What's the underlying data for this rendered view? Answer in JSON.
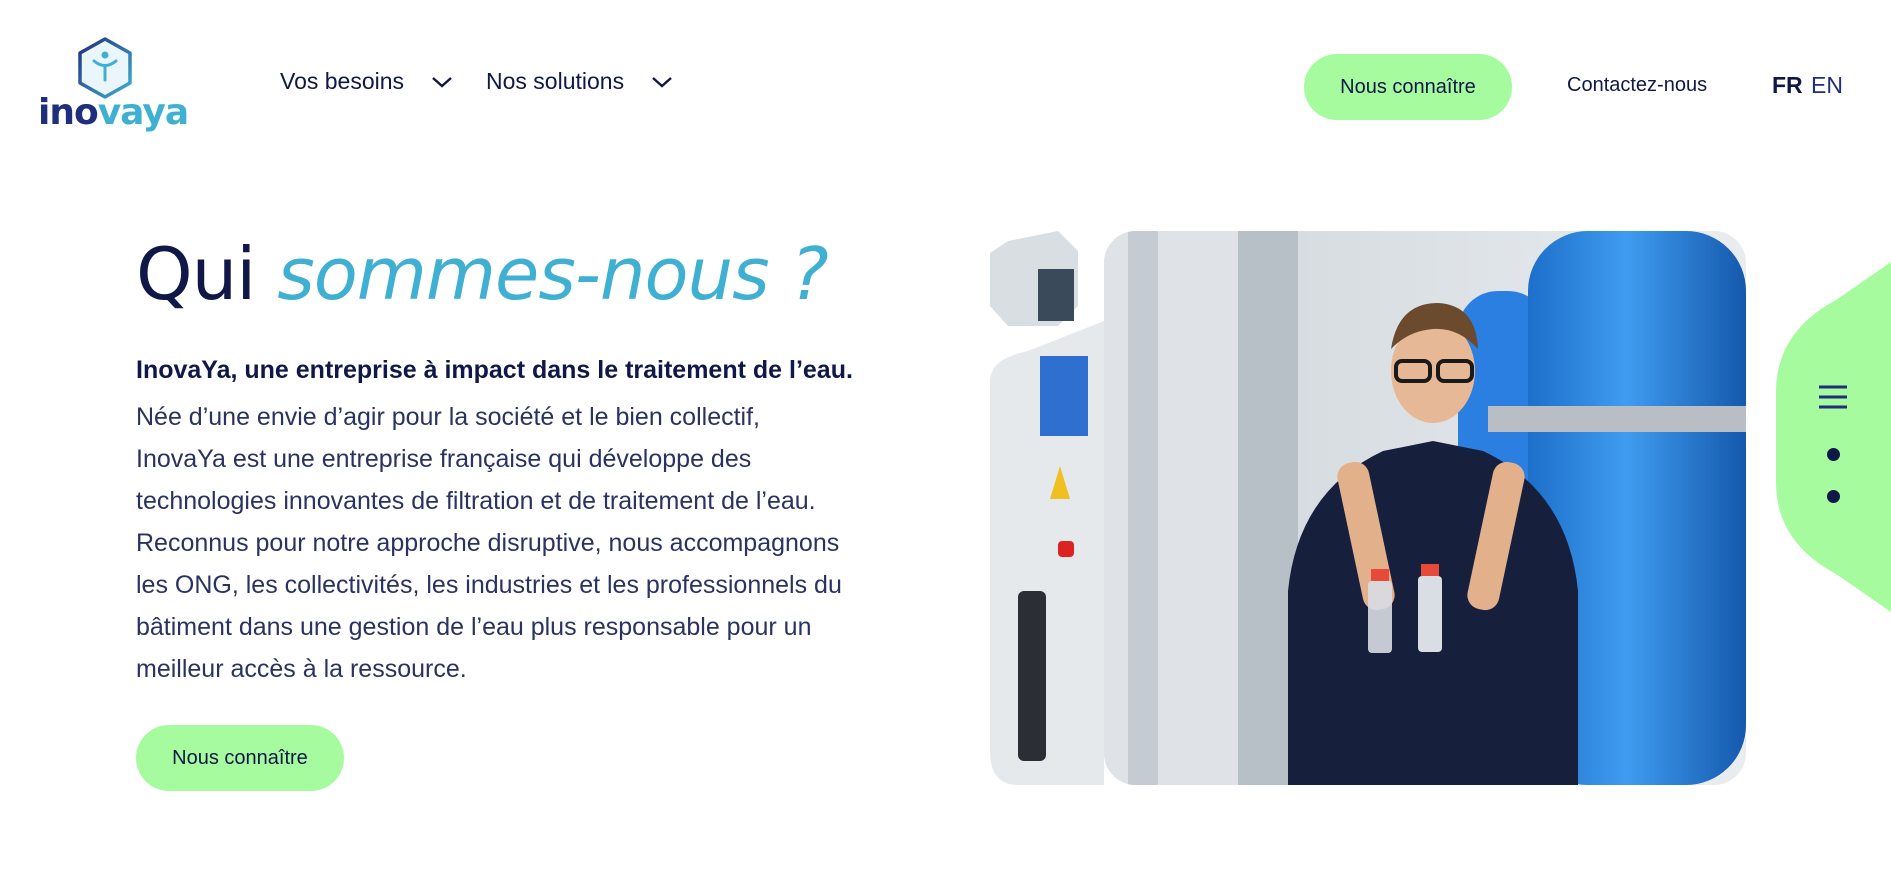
{
  "header": {
    "logo_text_a": "ino",
    "logo_text_b": "vaya",
    "nav": [
      {
        "label": "Vos besoins"
      },
      {
        "label": "Nos solutions"
      }
    ],
    "cta_label": "Nous connaître",
    "contact_label": "Contactez-nous",
    "lang_fr": "FR",
    "lang_en": "EN"
  },
  "hero": {
    "title_plain": "Qui ",
    "title_accent": "sommes-nous ?",
    "lead": "InovaYa, une entreprise à impact dans le traitement de l’eau.",
    "lines": [
      "Née d’une envie d’agir pour la société et le bien collectif,",
      "InovaYa est une entreprise française qui développe des",
      "technologies innovantes de filtration et de traitement de l’eau.",
      "Reconnus pour notre approche disruptive, nous accompagnons",
      "les ONG, les collectivités, les industries et les professionnels du",
      "bâtiment dans une gestion de l’eau plus responsable pour un",
      "meilleur accès à la ressource."
    ],
    "button_label": "Nous connaître"
  },
  "colors": {
    "navy": "#0f1846",
    "accent_blue": "#3fb0d1",
    "mint": "#a6fb9f"
  },
  "icons": [
    "inovaya-logo-icon",
    "chevron-down-icon",
    "hamburger-menu-icon"
  ]
}
